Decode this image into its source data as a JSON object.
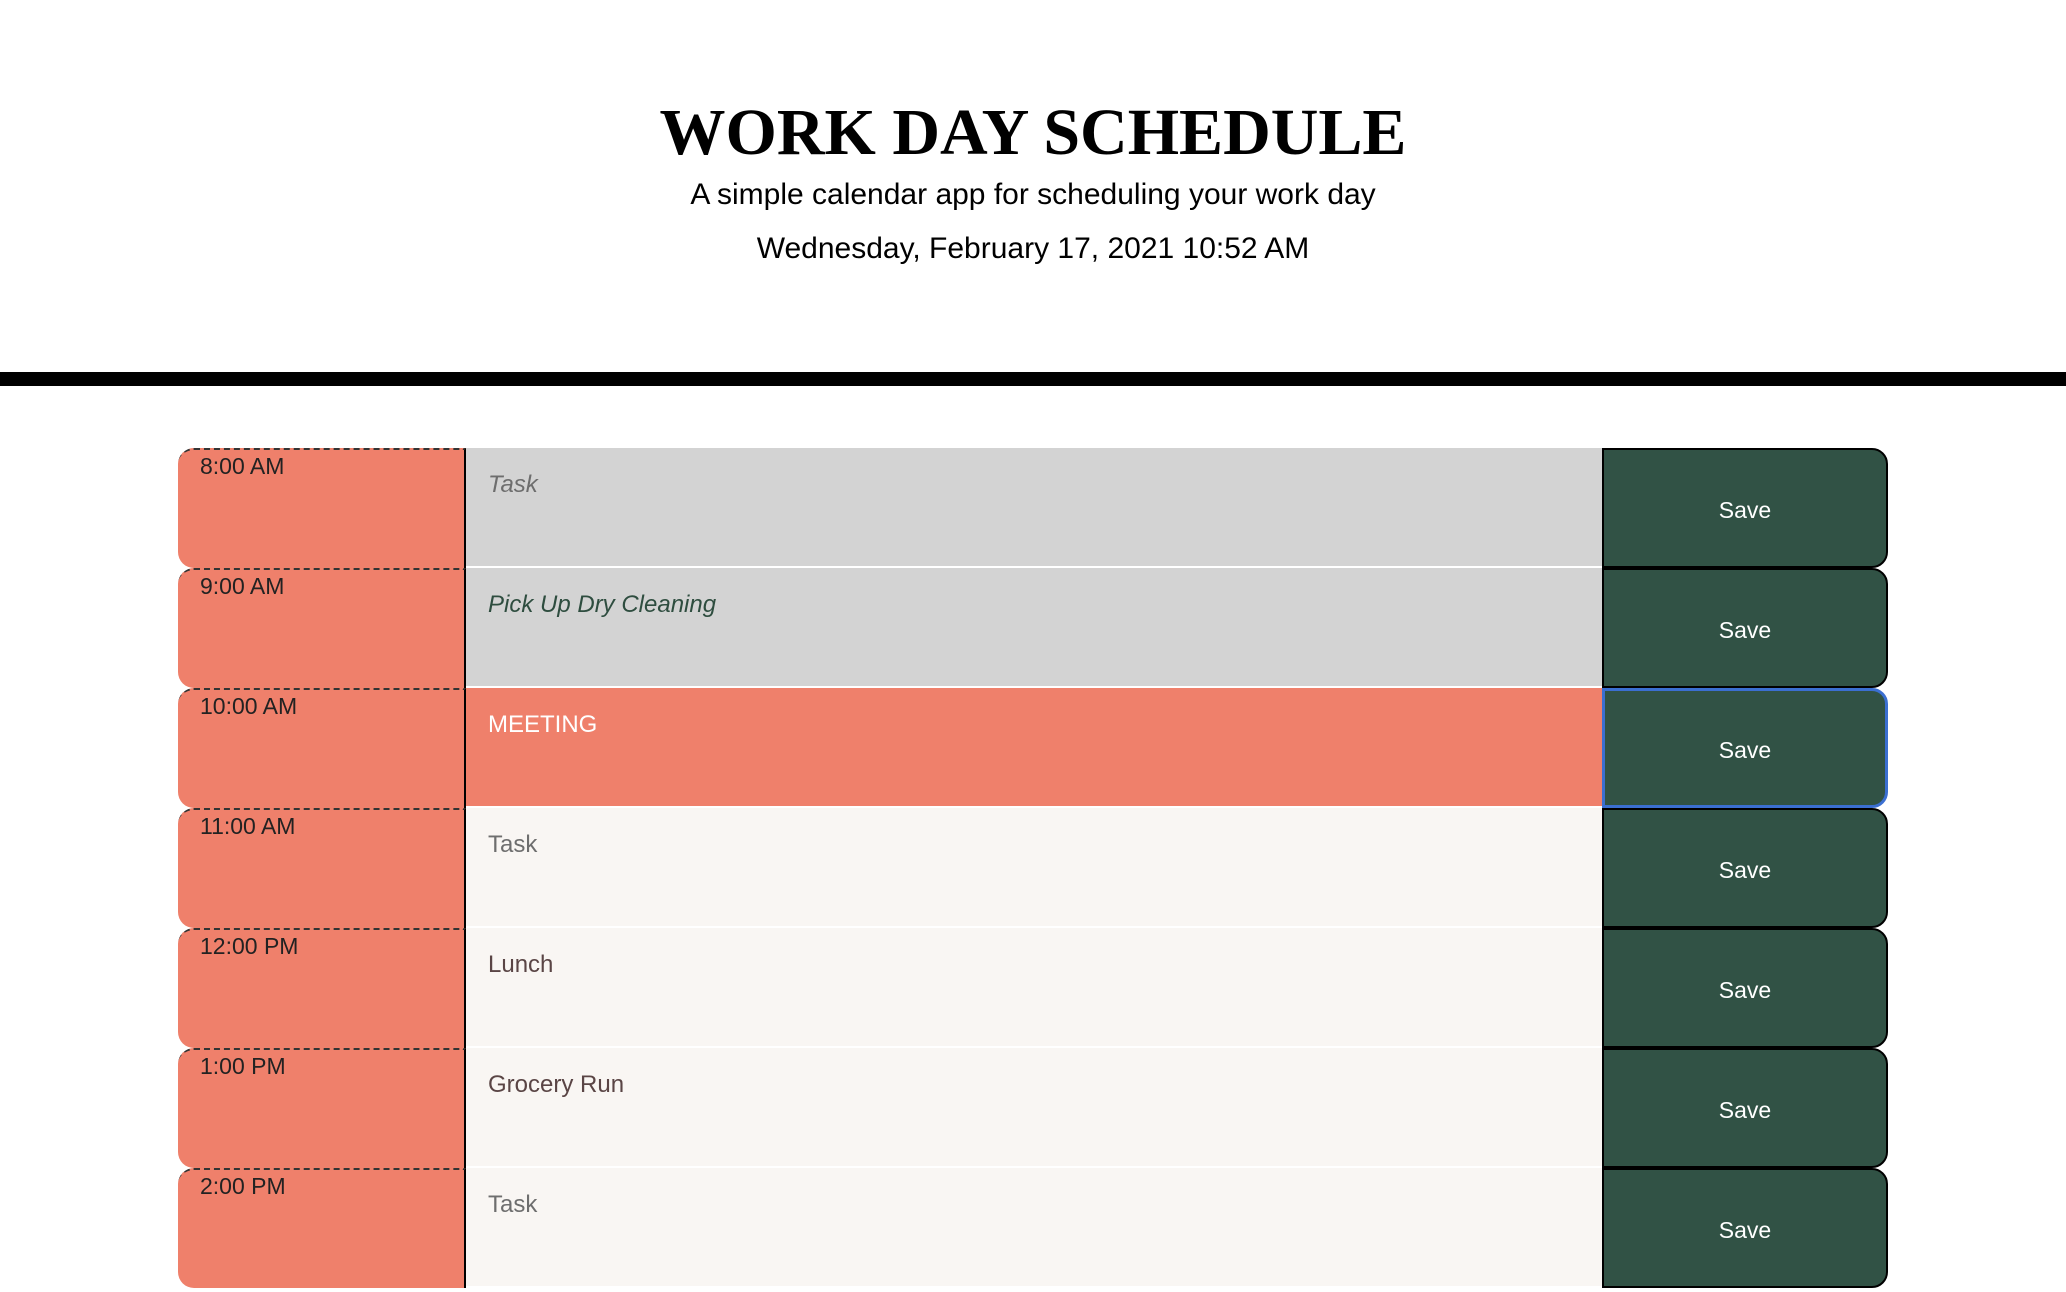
{
  "header": {
    "title": "WORK DAY SCHEDULE",
    "subtitle": "A simple calendar app for scheduling your work day",
    "current_day": "Wednesday, February 17, 2021 10:52 AM"
  },
  "colors": {
    "past": "#d3d3d3",
    "present": "#ef806b",
    "future": "#f9f6f3",
    "hour_block": "#ef806b",
    "save_button": "#315245",
    "focus_ring": "#3b6fd1"
  },
  "schedule": [
    {
      "hour": "8:00 AM",
      "text": "",
      "placeholder": "Task",
      "state": "past",
      "save_label": "Save"
    },
    {
      "hour": "9:00 AM",
      "text": "Pick Up Dry Cleaning",
      "placeholder": "Task",
      "state": "past",
      "save_label": "Save"
    },
    {
      "hour": "10:00 AM",
      "text": "MEETING",
      "placeholder": "Task",
      "state": "present",
      "save_label": "Save"
    },
    {
      "hour": "11:00 AM",
      "text": "",
      "placeholder": "Task",
      "state": "future",
      "save_label": "Save"
    },
    {
      "hour": "12:00 PM",
      "text": "Lunch",
      "placeholder": "Task",
      "state": "future",
      "save_label": "Save"
    },
    {
      "hour": "1:00 PM",
      "text": "Grocery Run",
      "placeholder": "Task",
      "state": "future",
      "save_label": "Save"
    },
    {
      "hour": "2:00 PM",
      "text": "",
      "placeholder": "Task",
      "state": "future",
      "save_label": "Save"
    }
  ]
}
